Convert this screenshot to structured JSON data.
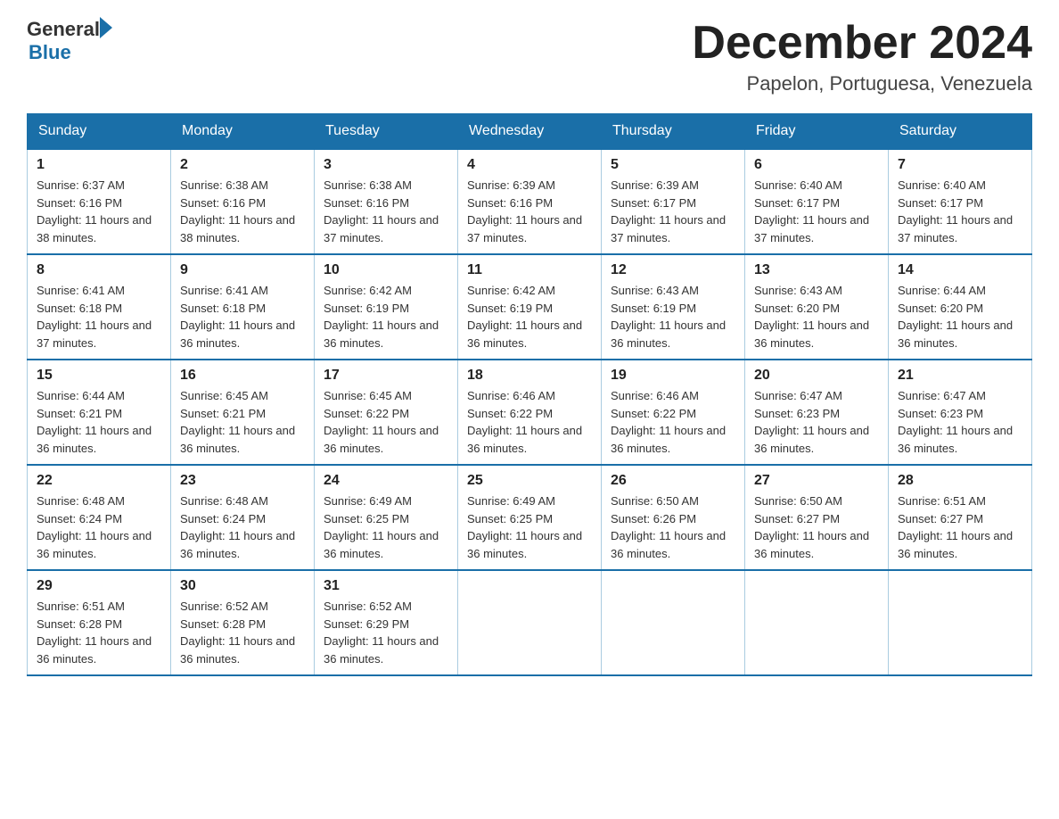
{
  "logo": {
    "general": "General",
    "blue": "Blue"
  },
  "title": "December 2024",
  "subtitle": "Papelon, Portuguesa, Venezuela",
  "weekdays": [
    "Sunday",
    "Monday",
    "Tuesday",
    "Wednesday",
    "Thursday",
    "Friday",
    "Saturday"
  ],
  "weeks": [
    [
      {
        "day": "1",
        "sunrise": "6:37 AM",
        "sunset": "6:16 PM",
        "daylight": "11 hours and 38 minutes."
      },
      {
        "day": "2",
        "sunrise": "6:38 AM",
        "sunset": "6:16 PM",
        "daylight": "11 hours and 38 minutes."
      },
      {
        "day": "3",
        "sunrise": "6:38 AM",
        "sunset": "6:16 PM",
        "daylight": "11 hours and 37 minutes."
      },
      {
        "day": "4",
        "sunrise": "6:39 AM",
        "sunset": "6:16 PM",
        "daylight": "11 hours and 37 minutes."
      },
      {
        "day": "5",
        "sunrise": "6:39 AM",
        "sunset": "6:17 PM",
        "daylight": "11 hours and 37 minutes."
      },
      {
        "day": "6",
        "sunrise": "6:40 AM",
        "sunset": "6:17 PM",
        "daylight": "11 hours and 37 minutes."
      },
      {
        "day": "7",
        "sunrise": "6:40 AM",
        "sunset": "6:17 PM",
        "daylight": "11 hours and 37 minutes."
      }
    ],
    [
      {
        "day": "8",
        "sunrise": "6:41 AM",
        "sunset": "6:18 PM",
        "daylight": "11 hours and 37 minutes."
      },
      {
        "day": "9",
        "sunrise": "6:41 AM",
        "sunset": "6:18 PM",
        "daylight": "11 hours and 36 minutes."
      },
      {
        "day": "10",
        "sunrise": "6:42 AM",
        "sunset": "6:19 PM",
        "daylight": "11 hours and 36 minutes."
      },
      {
        "day": "11",
        "sunrise": "6:42 AM",
        "sunset": "6:19 PM",
        "daylight": "11 hours and 36 minutes."
      },
      {
        "day": "12",
        "sunrise": "6:43 AM",
        "sunset": "6:19 PM",
        "daylight": "11 hours and 36 minutes."
      },
      {
        "day": "13",
        "sunrise": "6:43 AM",
        "sunset": "6:20 PM",
        "daylight": "11 hours and 36 minutes."
      },
      {
        "day": "14",
        "sunrise": "6:44 AM",
        "sunset": "6:20 PM",
        "daylight": "11 hours and 36 minutes."
      }
    ],
    [
      {
        "day": "15",
        "sunrise": "6:44 AM",
        "sunset": "6:21 PM",
        "daylight": "11 hours and 36 minutes."
      },
      {
        "day": "16",
        "sunrise": "6:45 AM",
        "sunset": "6:21 PM",
        "daylight": "11 hours and 36 minutes."
      },
      {
        "day": "17",
        "sunrise": "6:45 AM",
        "sunset": "6:22 PM",
        "daylight": "11 hours and 36 minutes."
      },
      {
        "day": "18",
        "sunrise": "6:46 AM",
        "sunset": "6:22 PM",
        "daylight": "11 hours and 36 minutes."
      },
      {
        "day": "19",
        "sunrise": "6:46 AM",
        "sunset": "6:22 PM",
        "daylight": "11 hours and 36 minutes."
      },
      {
        "day": "20",
        "sunrise": "6:47 AM",
        "sunset": "6:23 PM",
        "daylight": "11 hours and 36 minutes."
      },
      {
        "day": "21",
        "sunrise": "6:47 AM",
        "sunset": "6:23 PM",
        "daylight": "11 hours and 36 minutes."
      }
    ],
    [
      {
        "day": "22",
        "sunrise": "6:48 AM",
        "sunset": "6:24 PM",
        "daylight": "11 hours and 36 minutes."
      },
      {
        "day": "23",
        "sunrise": "6:48 AM",
        "sunset": "6:24 PM",
        "daylight": "11 hours and 36 minutes."
      },
      {
        "day": "24",
        "sunrise": "6:49 AM",
        "sunset": "6:25 PM",
        "daylight": "11 hours and 36 minutes."
      },
      {
        "day": "25",
        "sunrise": "6:49 AM",
        "sunset": "6:25 PM",
        "daylight": "11 hours and 36 minutes."
      },
      {
        "day": "26",
        "sunrise": "6:50 AM",
        "sunset": "6:26 PM",
        "daylight": "11 hours and 36 minutes."
      },
      {
        "day": "27",
        "sunrise": "6:50 AM",
        "sunset": "6:27 PM",
        "daylight": "11 hours and 36 minutes."
      },
      {
        "day": "28",
        "sunrise": "6:51 AM",
        "sunset": "6:27 PM",
        "daylight": "11 hours and 36 minutes."
      }
    ],
    [
      {
        "day": "29",
        "sunrise": "6:51 AM",
        "sunset": "6:28 PM",
        "daylight": "11 hours and 36 minutes."
      },
      {
        "day": "30",
        "sunrise": "6:52 AM",
        "sunset": "6:28 PM",
        "daylight": "11 hours and 36 minutes."
      },
      {
        "day": "31",
        "sunrise": "6:52 AM",
        "sunset": "6:29 PM",
        "daylight": "11 hours and 36 minutes."
      },
      null,
      null,
      null,
      null
    ]
  ]
}
